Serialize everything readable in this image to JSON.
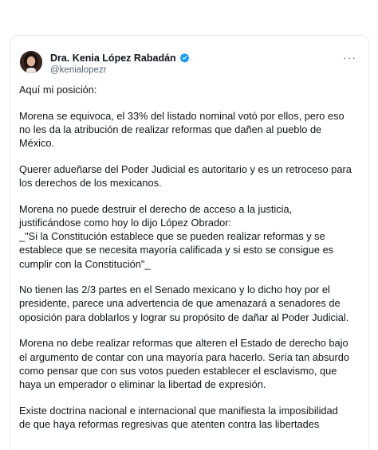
{
  "author": {
    "display_name": "Dra. Kenia López Rabadán",
    "handle": "@kenialopezr",
    "verified": true,
    "avatar": "avatar-photo",
    "verified_color": "#1d9bf0"
  },
  "menu": {
    "more_label": "···",
    "icon": "more-horizontal-icon"
  },
  "post": {
    "paragraphs": [
      {
        "lines": [
          "Aquí mi posición:"
        ]
      },
      {
        "lines": [
          "Morena se equivoca, el 33% del listado nominal votó por ellos, pero eso",
          "no les da la atribución de realizar reformas que dañen al pueblo de",
          "México."
        ]
      },
      {
        "lines": [
          "Querer adueñarse del Poder Judicial es autoritario y es un retroceso para",
          "los derechos de los mexicanos."
        ]
      },
      {
        "lines": [
          "Morena no puede destruir el derecho de acceso a la justicia,",
          "justificándose como hoy lo dijo López Obrador:",
          "_\"Si la Constitución establece que se pueden realizar reformas y se",
          "establece que se necesita mayoría calificada y si esto se consigue es",
          "cumplir con la Constitución\"_"
        ]
      },
      {
        "lines": [
          "No tienen las 2/3 partes en el Senado mexicano y lo dicho hoy por el",
          "presidente, parece una advertencia de que amenazará a senadores de",
          "oposición para doblarlos y lograr su propósito de dañar al Poder Judicial."
        ]
      },
      {
        "lines": [
          "Morena no debe realizar reformas que alteren el Estado de derecho bajo",
          "el argumento de contar con una mayoría para hacerlo. Sería tan absurdo",
          "como pensar que con sus votos pueden establecer el esclavismo, que",
          "haya un emperador o eliminar la libertad de expresión."
        ]
      },
      {
        "lines": [
          "Existe doctrina nacional e internacional que manifiesta la imposibilidad",
          "de que haya reformas regresivas que atenten contra las libertades"
        ]
      }
    ]
  }
}
